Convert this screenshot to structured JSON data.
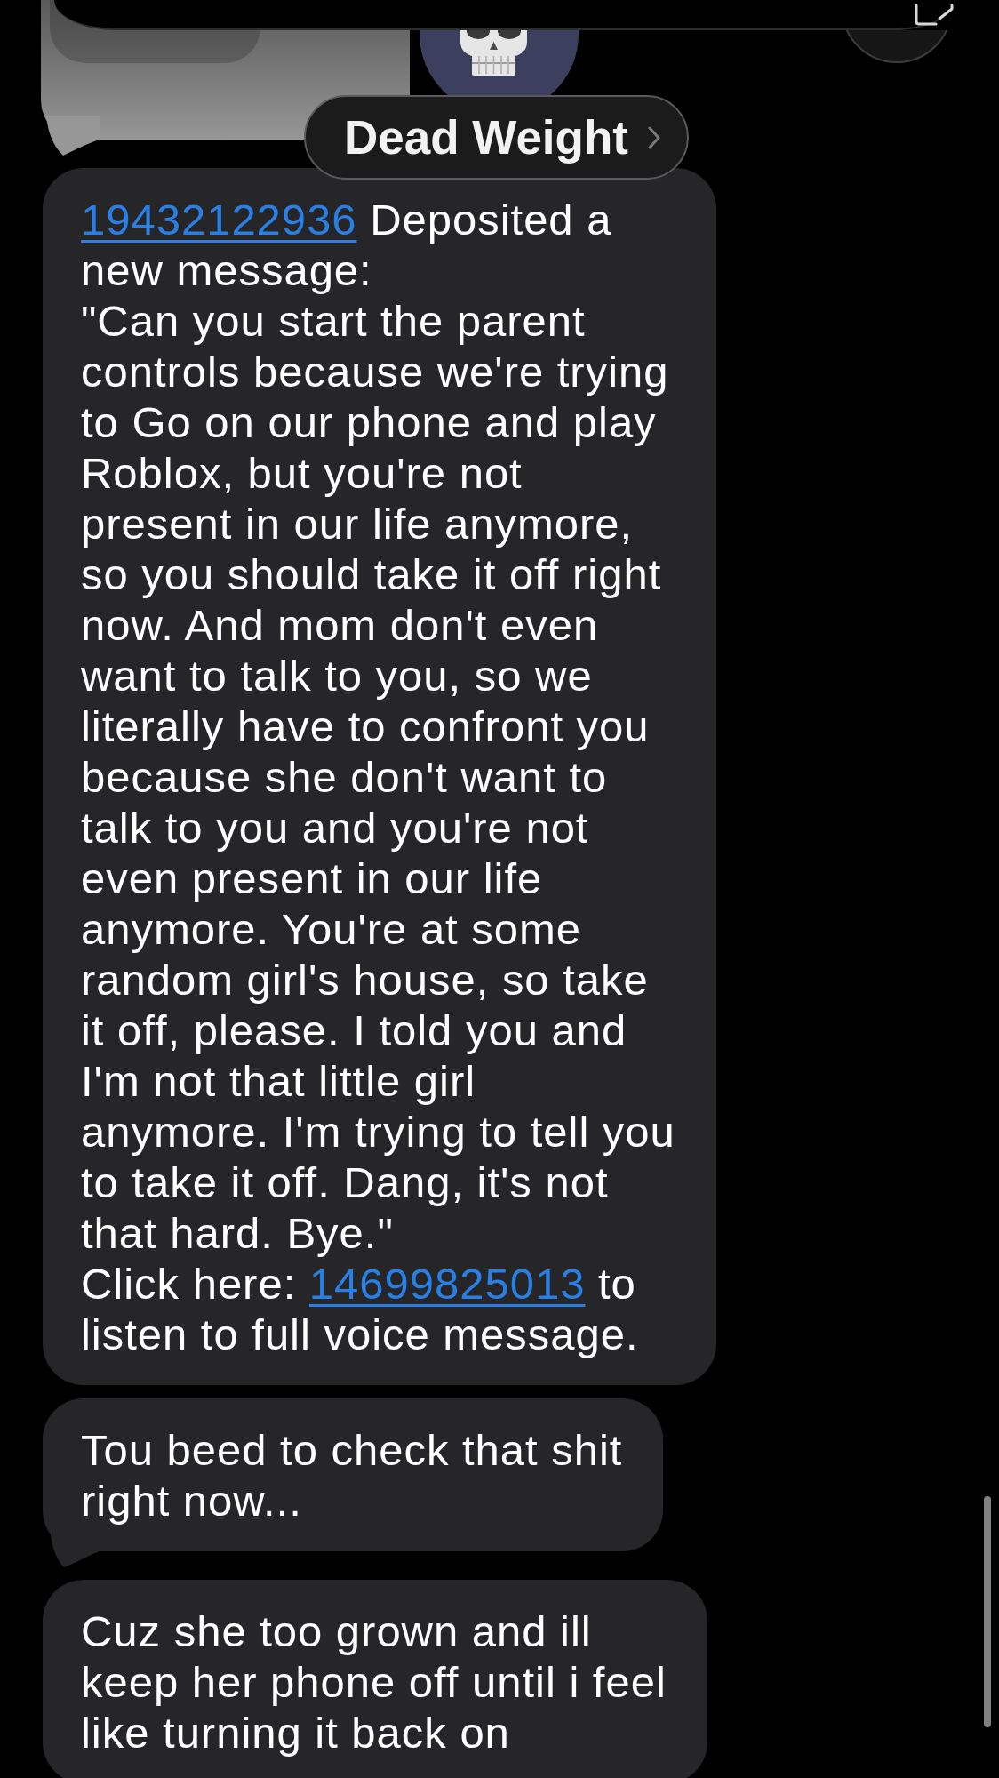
{
  "header": {
    "contact_name": "Dead Weight"
  },
  "messages": [
    {
      "tail": false,
      "segments": [
        {
          "kind": "link",
          "text": "19432122936"
        },
        {
          "kind": "text",
          "text": " Deposited a\nnew message:\n\"Can you start the parent\ncontrols because we're trying\nto Go on our phone and play\nRoblox, but you're not\npresent in our life anymore,\nso you should take it off right\nnow. And mom don't even\nwant to talk to you, so we\nliterally have to confront you\nbecause she don't want to\ntalk to you and you're not\neven present in our life\nanymore. You're at some\nrandom girl's house, so take\nit off, please. I told you and\nI'm not that little girl\nanymore. I'm trying to tell you\nto take it off. Dang, it's not\nthat hard. Bye.\"\nClick here: "
        },
        {
          "kind": "link",
          "text": "14699825013"
        },
        {
          "kind": "text",
          "text": " to\nlisten to full voice message."
        }
      ]
    },
    {
      "tail": true,
      "segments": [
        {
          "kind": "text",
          "text": "Tou beed to check that shit\nright now..."
        }
      ]
    },
    {
      "tail": false,
      "segments": [
        {
          "kind": "text",
          "text": "Cuz she too grown and ill\nkeep her phone off until i feel\nlike turning it back on"
        }
      ]
    }
  ]
}
